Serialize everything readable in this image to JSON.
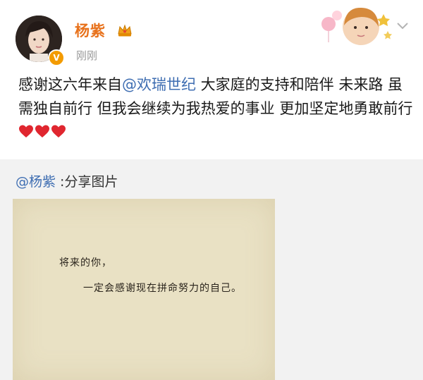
{
  "post": {
    "author": {
      "name": "杨紫",
      "avatar_icon": "profile-photo",
      "badge_icon": "crown-icon",
      "verified_icon": "verified-v-icon"
    },
    "timestamp": "刚刚",
    "content": {
      "prefix": "感谢这六年来自",
      "mention": "@欢瑞世纪",
      "suffix": " 大家庭的支持和陪伴 未来路 虽需独自前行 但我会继续为我热爱的事业 更加坚定地勇敢前行",
      "hearts_icon": "red-heart-icons"
    }
  },
  "repost": {
    "mention": "@杨紫",
    "label": " :分享图片",
    "image": {
      "line1": "将来的你，",
      "line2": "一定会感谢现在拼命努力的自己。"
    }
  },
  "colors": {
    "username": "#e8721c",
    "mention": "#3f6eb2",
    "timestamp": "#9a9a9a",
    "repost_bg": "#f2f2f2",
    "photo_bg": "#e9e1c4",
    "heart": "#e0262f"
  }
}
